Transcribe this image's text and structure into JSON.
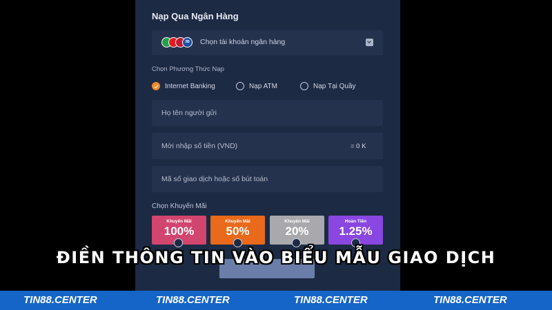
{
  "panel": {
    "title": "Nạp Qua Ngân Hàng",
    "bank_select": {
      "label": "Chọn tài khoản ngân hàng",
      "logo_colors": [
        "#1fa34a",
        "#e21b23",
        "#c21a2c",
        "#1c4fa1"
      ],
      "logo_text": "3B"
    },
    "method": {
      "label": "Chọn Phương Thức Nạp",
      "options": [
        {
          "label": "Internet Banking",
          "selected": true
        },
        {
          "label": "Nạp ATM",
          "selected": false
        },
        {
          "label": "Nạp Tại Quầy",
          "selected": false
        }
      ]
    },
    "fields": {
      "name_placeholder": "Họ tên người gửi",
      "amount_placeholder": "Mời nhập số tiền (VND)",
      "amount_value": "= 0 K",
      "txn_placeholder": "Mã số giao dịch hoặc số bút toán"
    },
    "promos": {
      "label": "Chọn Khuyến Mãi",
      "items": [
        {
          "title": "Khuyến Mãi",
          "value": "100%",
          "color": "#d2456f"
        },
        {
          "title": "Khuyến Mãi",
          "value": "50%",
          "color": "#e86a1a"
        },
        {
          "title": "Khuyến Mãi",
          "value": "20%",
          "color": "#a9a9ad"
        },
        {
          "title": "Hoàn Tiền",
          "value": "1.25%",
          "color": "#8a46e0"
        }
      ]
    }
  },
  "caption": "ĐIỀN THÔNG TIN VÀO BIỂU MẪU GIAO DỊCH",
  "footer": {
    "items": [
      "TIN88.CENTER",
      "TIN88.CENTER",
      "TIN88.CENTER",
      "TIN88.CENTER"
    ],
    "color": "#1565c8"
  }
}
